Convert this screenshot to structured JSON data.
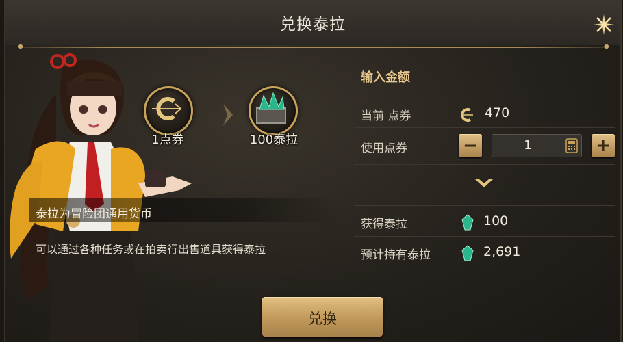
{
  "dialog": {
    "title": "兑换泰拉"
  },
  "exchange_visual": {
    "from_label": "1点券",
    "to_label": "100泰拉"
  },
  "info": {
    "main": "泰拉为冒险团通用货币",
    "sub": "可以通过各种任务或在拍卖行出售道具获得泰拉"
  },
  "panel": {
    "section_title": "输入金额",
    "current_label": "当前 点券",
    "current_value": "470",
    "use_label": "使用点券",
    "quantity": "1",
    "obtain_label": "获得泰拉",
    "obtain_value": "100",
    "expected_label": "预计持有泰拉",
    "expected_value": "2,691"
  },
  "action": {
    "exchange_label": "兑换"
  },
  "icons": {
    "close": "close-x-icon",
    "coupon": "coupon-c-icon",
    "gem": "green-gem-icon",
    "calculator": "calculator-icon",
    "arrow": "chevron-right-icon",
    "down": "chevron-down-icon"
  },
  "colors": {
    "gold": "#c9a35a",
    "gem": "#2bb58a",
    "text": "#e8e2d4",
    "accent_title": "#e7c88e"
  }
}
